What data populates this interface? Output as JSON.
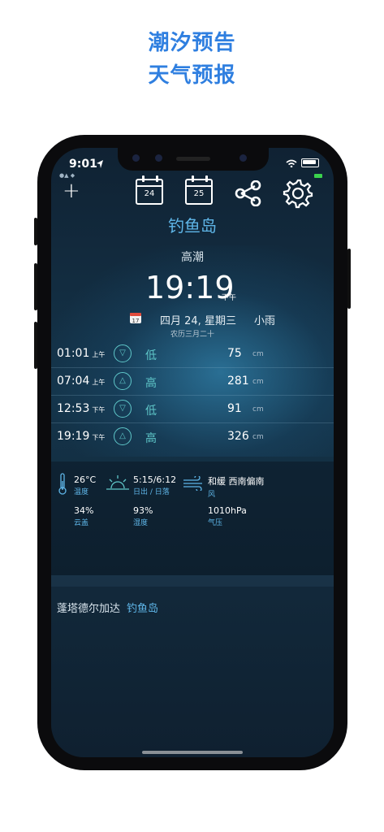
{
  "promo": {
    "line1": "潮汐预告",
    "line2": "天气预报"
  },
  "status": {
    "time": "9:01",
    "carrier_sub": "●▲ ◆"
  },
  "toolbar": {
    "add_icon": "+",
    "cal_today": "24",
    "cal_tomorrow": "25"
  },
  "location": "钓鱼岛",
  "tide_type": "高潮",
  "next_tide": {
    "time": "19:19",
    "ampm": "下午"
  },
  "date": {
    "text": "四月 24, 星期三",
    "weather": "小雨",
    "lunar": "农历三月二十"
  },
  "tides": [
    {
      "time": "01:01",
      "ampm": "上午",
      "dir": "▽",
      "type": "低",
      "height": "75",
      "unit": "cm"
    },
    {
      "time": "07:04",
      "ampm": "上午",
      "dir": "△",
      "type": "高",
      "height": "281",
      "unit": "cm"
    },
    {
      "time": "12:53",
      "ampm": "下午",
      "dir": "▽",
      "type": "低",
      "height": "91",
      "unit": "cm"
    },
    {
      "time": "19:19",
      "ampm": "下午",
      "dir": "△",
      "type": "高",
      "height": "326",
      "unit": "cm"
    }
  ],
  "weather": {
    "temp": "26°C",
    "temp_label": "温度",
    "sun": "5:15/6:12",
    "sun_label": "日出 / 日落",
    "wind": "和缓 西南偏南",
    "wind_label": "风",
    "cloud": "34%",
    "cloud_label": "云盖",
    "humidity": "93%",
    "humidity_label": "湿度",
    "pressure": "1010hPa",
    "pressure_label": "气压"
  },
  "footer": {
    "region": "蓬塔德尔加达",
    "place": "钓鱼岛"
  },
  "colors": {
    "accent": "#5fb6e8",
    "tide_icon": "#5fc7c9",
    "promo": "#2f7fe0"
  }
}
